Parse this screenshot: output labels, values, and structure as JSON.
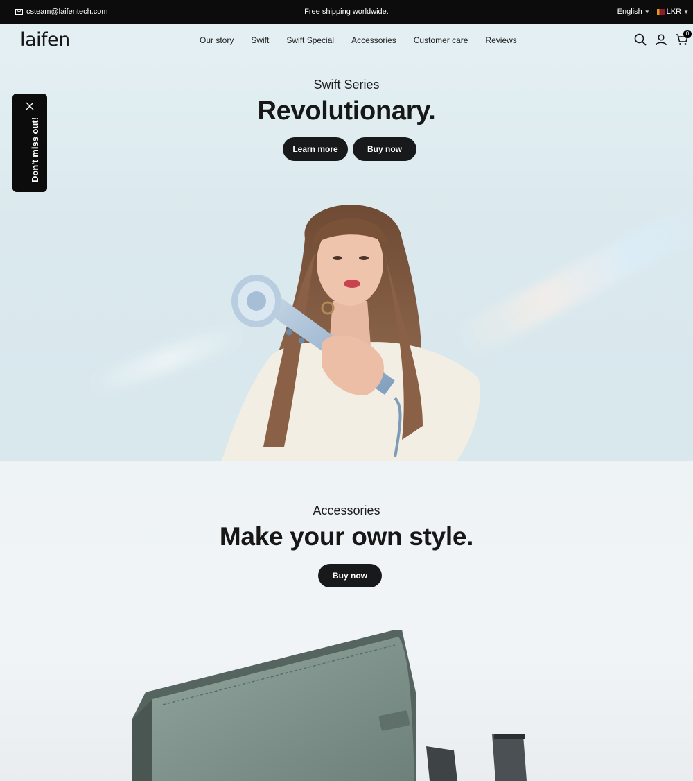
{
  "topbar": {
    "email": "csteam@laifentech.com",
    "announcement": "Free shipping worldwide.",
    "language": "English",
    "currency": "LKR"
  },
  "header": {
    "logo": "laifen",
    "nav": [
      "Our story",
      "Swift",
      "Swift Special",
      "Accessories",
      "Customer care",
      "Reviews"
    ],
    "cart_count": "0"
  },
  "hero": {
    "eyebrow": "Swift Series",
    "headline": "Revolutionary.",
    "learn_more_label": "Learn more",
    "buy_now_label": "Buy now"
  },
  "popup": {
    "text": "Don't miss out!"
  },
  "accessories": {
    "eyebrow": "Accessories",
    "headline": "Make your own style.",
    "buy_now_label": "Buy now"
  },
  "colors": {
    "dark": "#17191a",
    "topbar": "#0c0c0c",
    "hero_bg": "#dbe9ee",
    "dryer_blue": "#9fb8cf",
    "bag_green": "#7e918a"
  }
}
